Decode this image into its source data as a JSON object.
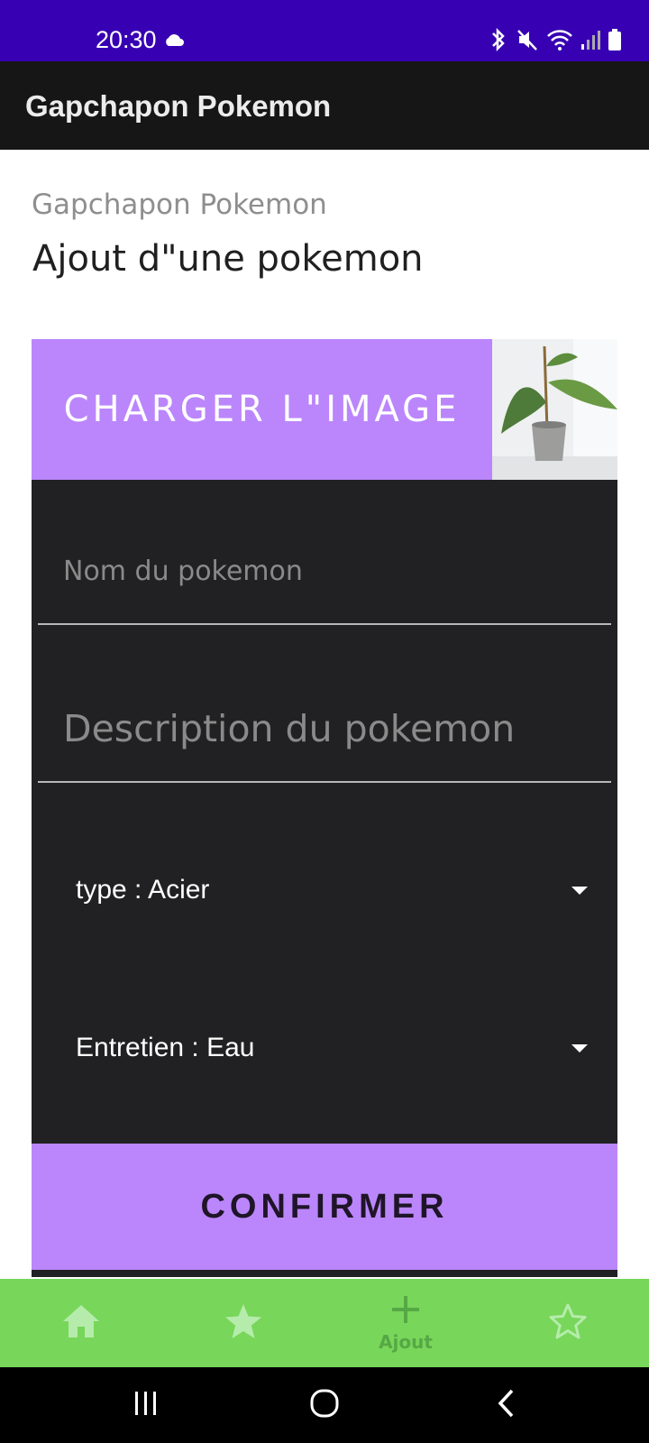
{
  "status_bar": {
    "time": "20:30",
    "color": "#3700b3",
    "icons": [
      "cloud-icon",
      "bluetooth-icon",
      "mute-icon",
      "wifi-icon",
      "signal-icon",
      "battery-icon"
    ]
  },
  "app_bar": {
    "title": "Gapchapon Pokemon"
  },
  "header": {
    "subtitle": "Gapchapon Pokemon",
    "title": "Ajout d\"une pokemon"
  },
  "form": {
    "load_image_label": "CHARGER L\"IMAGE",
    "name_placeholder": "Nom du pokemon",
    "description_placeholder": "Description du pokemon",
    "type_select_value": "type : Acier",
    "care_select_value": "Entretien : Eau",
    "confirm_label": "CONFIRMER",
    "accent_color": "#bb86fc"
  },
  "bottom_nav": {
    "color": "#78d65a",
    "items": [
      {
        "icon": "home-icon",
        "label": ""
      },
      {
        "icon": "star-icon",
        "label": ""
      },
      {
        "icon": "plus-icon",
        "label": "Ajout"
      },
      {
        "icon": "star-outline-icon",
        "label": ""
      }
    ]
  },
  "system_nav": {
    "icons": [
      "recents-icon",
      "home-circle-icon",
      "back-icon"
    ]
  }
}
